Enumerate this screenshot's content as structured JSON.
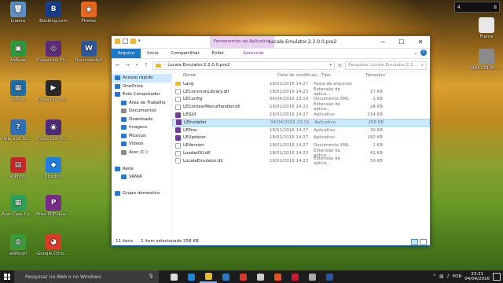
{
  "desktop": {
    "icons": [
      {
        "label": "Lixeira",
        "color": "#5a8fc8",
        "glyph": "🗑"
      },
      {
        "label": "Booking.com",
        "color": "#163d8a",
        "glyph": "B"
      },
      {
        "label": "Firefox",
        "color": "#e8671c",
        "glyph": "◉"
      },
      {
        "label": "AsBeep",
        "color": "#2a9a3c",
        "glyph": "▣"
      },
      {
        "label": "CyberLink PhotoDirector 5",
        "color": "#5b2b7c",
        "glyph": "◎"
      },
      {
        "label": "Documento1",
        "color": "#2b579a",
        "glyph": "W"
      },
      {
        "label": "acPiew",
        "color": "#1d6ea8",
        "glyph": "▦"
      },
      {
        "label": "CyberLink PowerDirector",
        "color": "#2a2a2a",
        "glyph": "▶"
      },
      {
        "label": "Help and Support",
        "color": "#2f6fb3",
        "glyph": "?"
      },
      {
        "label": "CyberLink PowerDVD 12",
        "color": "#4b2a7a",
        "glyph": "◉"
      },
      {
        "label": "abPhoto",
        "color": "#c8282c",
        "glyph": "▤"
      },
      {
        "label": "Dropbox",
        "color": "#1e7fe0",
        "glyph": "◆"
      },
      {
        "label": "Acer Care Center",
        "color": "#2aa05a",
        "glyph": "▦"
      },
      {
        "label": "Free PDF Reader",
        "color": "#7a2a8a",
        "glyph": "P"
      },
      {
        "label": "abPeopl",
        "color": "#3a9a3a",
        "glyph": "◍"
      },
      {
        "label": "Google Chrome",
        "color": "#d93a2a",
        "glyph": "◕"
      },
      {
        "label": "Frame",
        "color": "#e8e8e8",
        "glyph": ""
      },
      {
        "label": "WIN_20160_Sou...",
        "color": "#8a8a8a",
        "glyph": ""
      }
    ],
    "widget": {
      "left": "4",
      "right": "8"
    }
  },
  "explorer": {
    "title": "Locale.Emulator.2.2.0.0.pre2",
    "context_tab": "Ferramentas de Aplicativo",
    "ribbon_tabs": [
      {
        "label": "Arquivo"
      },
      {
        "label": "Início"
      },
      {
        "label": "Compartilhar"
      },
      {
        "label": "Exibir"
      },
      {
        "label": "Gerenciar"
      }
    ],
    "address": "Locale.Emulator.2.2.0.0.pre2",
    "search_placeholder": "Pesquisar Locale.Emulator.2.2....",
    "nav": [
      {
        "label": "Acesso rápido",
        "color": "#2b78d4",
        "indent": 0,
        "selected": true
      },
      {
        "label": "OneDrive",
        "color": "#2b78d4",
        "indent": 0,
        "selected": false
      },
      {
        "label": "Este Computador",
        "color": "#2b78d4",
        "indent": 0,
        "selected": false
      },
      {
        "label": "Área de Trabalho",
        "color": "#2b78d4",
        "indent": 1,
        "selected": false
      },
      {
        "label": "Documentos",
        "color": "#8a8a8a",
        "indent": 1,
        "selected": false
      },
      {
        "label": "Downloads",
        "color": "#2b78d4",
        "indent": 1,
        "selected": false
      },
      {
        "label": "Imagens",
        "color": "#2b78d4",
        "indent": 1,
        "selected": false
      },
      {
        "label": "Músicas",
        "color": "#2b78d4",
        "indent": 1,
        "selected": false
      },
      {
        "label": "Vídeos",
        "color": "#2b78d4",
        "indent": 1,
        "selected": false
      },
      {
        "label": "Acer (C:)",
        "color": "#8a8a8a",
        "indent": 1,
        "selected": false
      },
      {
        "label": "",
        "color": "transparent",
        "indent": 0,
        "selected": false
      },
      {
        "label": "Rede",
        "color": "#2b78d4",
        "indent": 0,
        "selected": false
      },
      {
        "label": "VANIA",
        "color": "#2b78d4",
        "indent": 1,
        "selected": false
      },
      {
        "label": "",
        "color": "transparent",
        "indent": 0,
        "selected": false
      },
      {
        "label": "Grupo doméstico",
        "color": "#2b78d4",
        "indent": 0,
        "selected": false
      }
    ],
    "columns": {
      "name": "Nome",
      "date": "Data de modificaç...",
      "type": "Tipo",
      "size": "Tamanho"
    },
    "files": [
      {
        "name": "Lang",
        "date": "18/01/2016 14:27",
        "type": "Pasta de arquivos",
        "size": "",
        "icon": "folder",
        "selected": false
      },
      {
        "name": "LECommonLibrary.dll",
        "date": "18/01/2016 14:23",
        "type": "Extensão de aplica...",
        "size": "17 KB",
        "icon": "dll",
        "selected": false
      },
      {
        "name": "LEConfig",
        "date": "04/04/2016 23:19",
        "type": "Documento XML",
        "size": "1 KB",
        "icon": "xml",
        "selected": false
      },
      {
        "name": "LEContextMenuHandler.dll",
        "date": "18/01/2016 14:23",
        "type": "Extensão de aplica...",
        "size": "24 KB",
        "icon": "dll",
        "selected": false
      },
      {
        "name": "LEGUI",
        "date": "18/01/2016 14:27",
        "type": "Aplicativo",
        "size": "214 KB",
        "icon": "app",
        "selected": false
      },
      {
        "name": "LEInstaller",
        "date": "04/04/2016 23:19",
        "type": "Aplicativo",
        "size": "258 KB",
        "icon": "app",
        "selected": true
      },
      {
        "name": "LEProc",
        "date": "18/01/2016 14:27",
        "type": "Aplicativo",
        "size": "30 KB",
        "icon": "app",
        "selected": false
      },
      {
        "name": "LEUpdater",
        "date": "18/01/2016 14:27",
        "type": "Aplicativo",
        "size": "192 KB",
        "icon": "app",
        "selected": false
      },
      {
        "name": "LEVersion",
        "date": "18/01/2016 14:27",
        "type": "Documento XML",
        "size": "1 KB",
        "icon": "xml",
        "selected": false
      },
      {
        "name": "LoaderDll.dll",
        "date": "18/01/2016 14:23",
        "type": "Extensão de aplica...",
        "size": "41 KB",
        "icon": "dll",
        "selected": false
      },
      {
        "name": "LocaleEmulator.dll",
        "date": "18/01/2016 14:23",
        "type": "Extensão de aplica...",
        "size": "59 KB",
        "icon": "dll",
        "selected": false
      }
    ],
    "status": {
      "count": "11 itens",
      "selection": "1 item selecionado  258 KB"
    }
  },
  "taskbar": {
    "search_placeholder": "Pesquisar na Web e no Windows",
    "apps": [
      {
        "name": "task-view",
        "color": "#dddddd"
      },
      {
        "name": "edge",
        "color": "#1e88d8"
      },
      {
        "name": "file-explorer",
        "color": "#e8b931"
      },
      {
        "name": "store",
        "color": "#2a78c8"
      },
      {
        "name": "chrome",
        "color": "#d93a2a"
      },
      {
        "name": "calculator",
        "color": "#cccccc"
      },
      {
        "name": "media-player",
        "color": "#e85020"
      },
      {
        "name": "opera",
        "color": "#c81a2a"
      },
      {
        "name": "settings",
        "color": "#aaaaaa"
      },
      {
        "name": "word",
        "color": "#2b579a"
      }
    ],
    "lang": "POR",
    "time": "23:21",
    "date": "04/04/2016"
  }
}
